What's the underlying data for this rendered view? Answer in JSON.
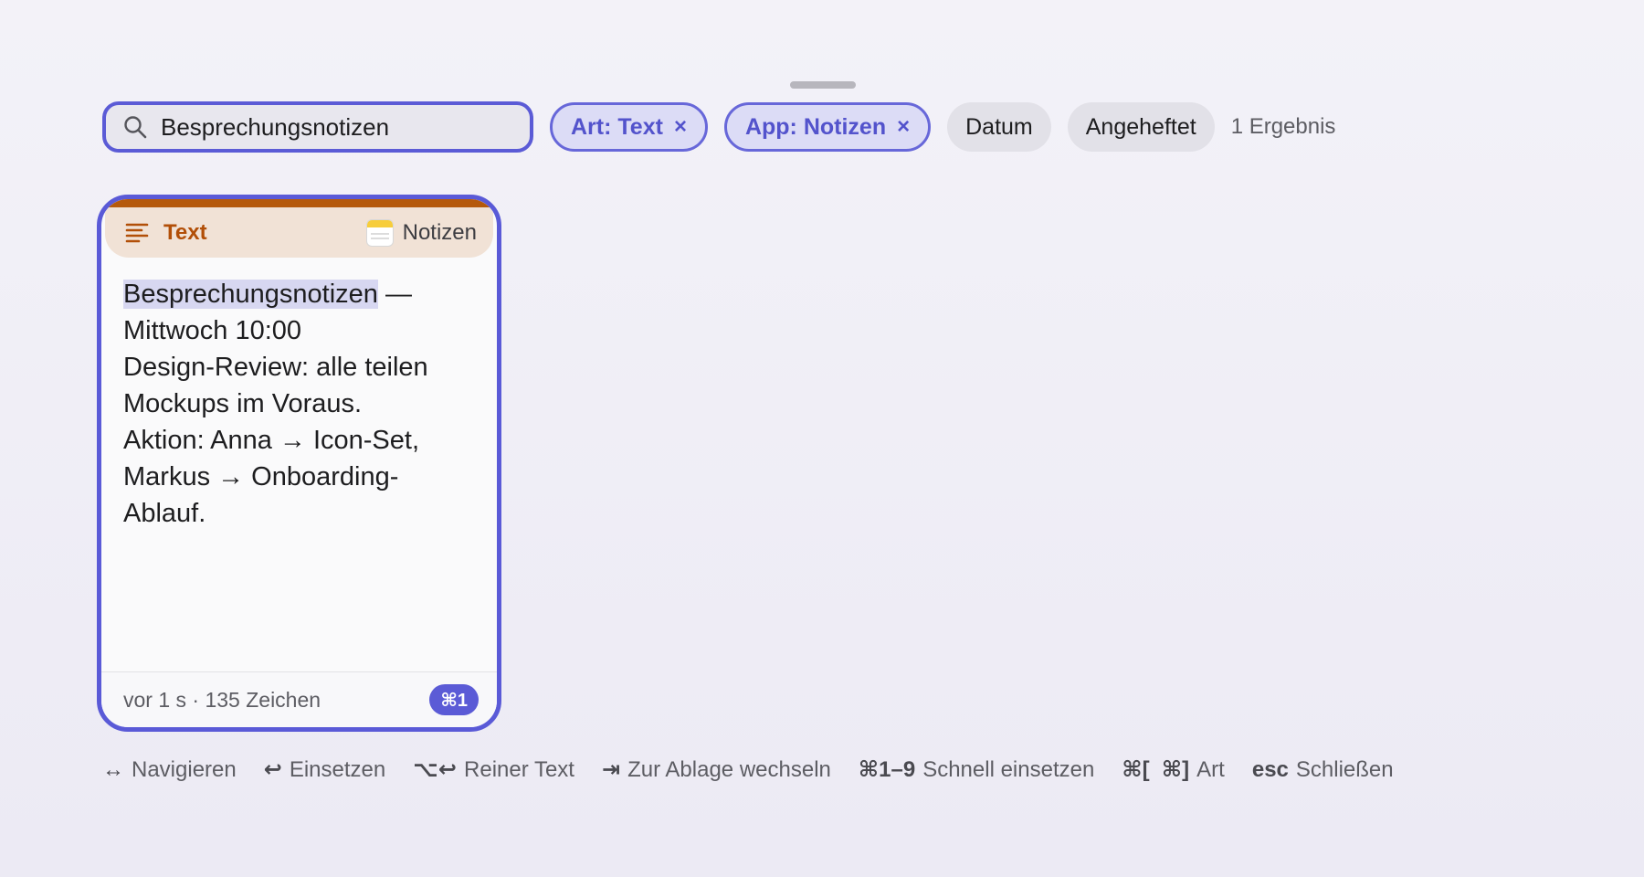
{
  "search": {
    "value": "Besprechungsnotizen"
  },
  "filters": [
    {
      "label": "Art: Text",
      "active": true,
      "remove": "×"
    },
    {
      "label": "App: Notizen",
      "active": true,
      "remove": "×"
    },
    {
      "label": "Datum",
      "active": false
    },
    {
      "label": "Angeheftet",
      "active": false
    }
  ],
  "result_count": "1 Ergebnis",
  "card": {
    "type": "Text",
    "type_icon": "text-lines-icon",
    "app": "Notizen",
    "app_icon": "notes-app-icon",
    "accent": "#b5590c",
    "highlight": "Besprechungsnotizen",
    "lines": [
      " —",
      "Mittwoch 10:00",
      "Design-Review: alle teilen",
      "Mockups im Voraus.",
      "Aktion: Anna → Icon-Set,",
      "Markus → Onboarding-",
      "Ablauf."
    ],
    "meta": "vor 1 s · 135 Zeichen",
    "shortcut": "⌘1"
  },
  "hints": [
    {
      "key": "↔",
      "label": "Navigieren"
    },
    {
      "key": "↩",
      "label": "Einsetzen"
    },
    {
      "key": "⌥↩",
      "label": "Reiner Text"
    },
    {
      "key": "⇥",
      "label": "Zur Ablage wechseln"
    },
    {
      "key": "⌘1–9",
      "label": "Schnell einsetzen"
    },
    {
      "key": "⌘[  ⌘]",
      "label": "Art"
    },
    {
      "key": "esc",
      "label": "Schließen"
    }
  ],
  "colors": {
    "accent": "#5b5bd6",
    "chip_active_bg": "#dcdcf6",
    "card_header_bg": "#f1e2d6"
  }
}
